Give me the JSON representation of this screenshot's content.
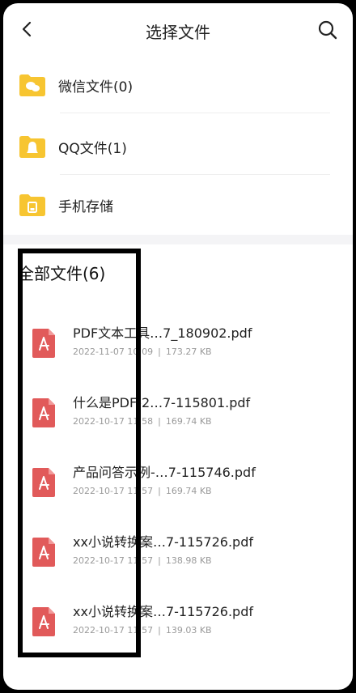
{
  "header": {
    "title": "选择文件",
    "back_icon": "chevron-left-icon",
    "search_icon": "search-icon"
  },
  "folders": [
    {
      "label": "微信文件(0)",
      "icon": "wechat-folder-icon"
    },
    {
      "label": "QQ文件(1)",
      "icon": "qq-folder-icon"
    },
    {
      "label": "手机存储",
      "icon": "storage-folder-icon"
    }
  ],
  "all_files": {
    "title": "全部文件(6)",
    "items": [
      {
        "name": "PDF文本工具…7_180902.pdf",
        "date": "2022-11-07 10:09",
        "size": "173.27 KB"
      },
      {
        "name": "什么是PDF-2…7-115801.pdf",
        "date": "2022-10-17 11:58",
        "size": "169.74 KB"
      },
      {
        "name": "产品问答示例-…7-115746.pdf",
        "date": "2022-10-17 11:57",
        "size": "169.74 KB"
      },
      {
        "name": "xx小说转换案…7-115726.pdf",
        "date": "2022-10-17 11:57",
        "size": "138.98 KB"
      },
      {
        "name": "xx小说转换案…7-115726.pdf",
        "date": "2022-10-17 11:57",
        "size": "139.03 KB"
      }
    ]
  },
  "colors": {
    "folder_yellow": "#F7C531",
    "pdf_red": "#E15A5A",
    "divider": "#EEEEEE",
    "meta_gray": "#9A9A9A"
  }
}
